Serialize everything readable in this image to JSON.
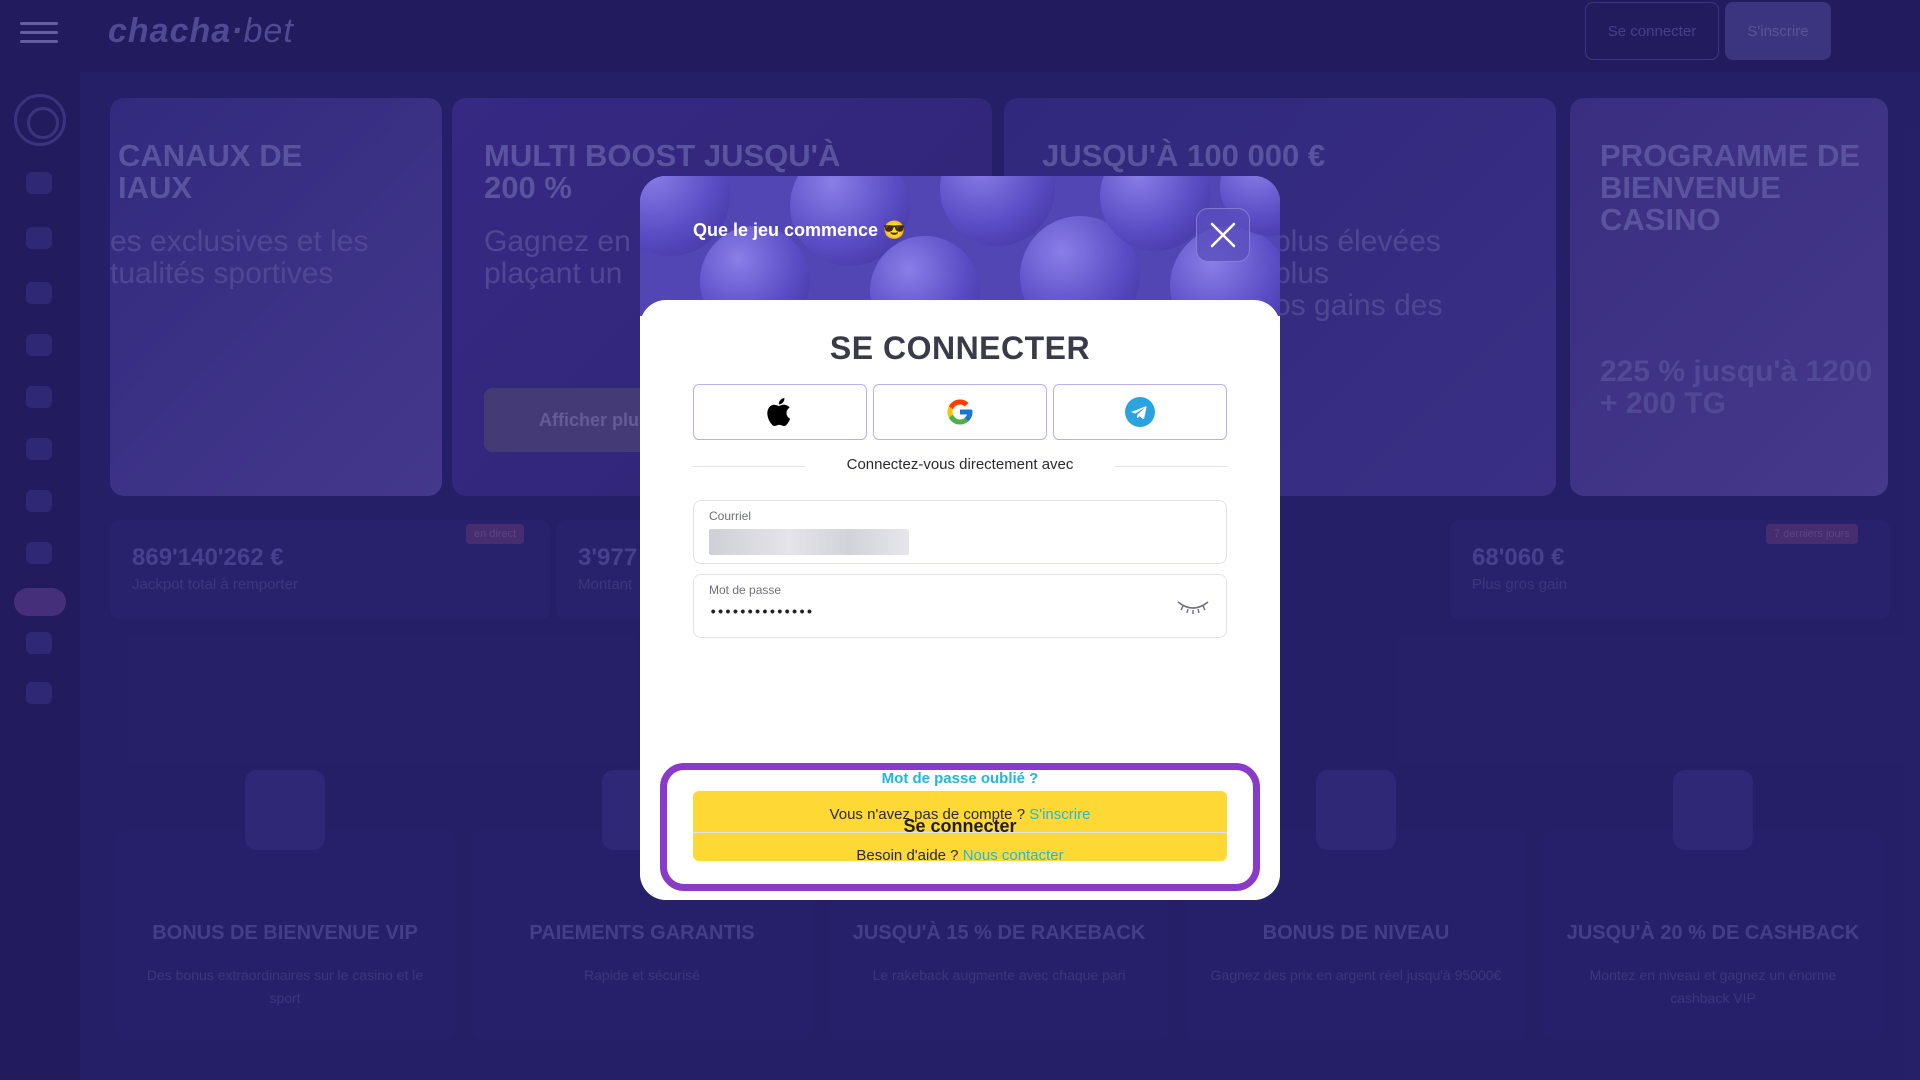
{
  "header": {
    "logo": "chacha",
    "logo_suffix": "bet",
    "login_label": "Se connecter",
    "signup_label": "S'inscrire"
  },
  "banners": [
    {
      "title": "CANAUX DE\nIAUX",
      "subtitle": "es exclusives et les\ntualités sportives"
    },
    {
      "title": "MULTI BOOST JUSQU'À\n200 %",
      "subtitle": "Gagnez en\nplaçant un",
      "button": "Afficher plus"
    },
    {
      "title": "JUSQU'À 100 000 €",
      "subtitle": "plus élevées\nplus\nos gains des"
    },
    {
      "title": "PROGRAMME DE\nBIENVENUE\n     CASINO",
      "promo": "225 % jusqu'à 1200\n+ 200 TG"
    }
  ],
  "stats": [
    {
      "value": "869'140'262 €",
      "label": "Jackpot total à remporter",
      "tag": "en direct"
    },
    {
      "value": "3'977",
      "label": "Montant"
    },
    {
      "value": "68'060 €",
      "label": "Plus gros gain",
      "tag": "7 derniers jours"
    }
  ],
  "features": [
    {
      "title": "BONUS DE BIENVENUE VIP",
      "desc": "Des bonus extraordinaires sur le casino et le sport"
    },
    {
      "title": "PAIEMENTS GARANTIS",
      "desc": "Rapide et sécurisé"
    },
    {
      "title": "JUSQU'À 15 % DE RAKEBACK",
      "desc": "Le rakeback augmente avec chaque pari"
    },
    {
      "title": "BONUS DE NIVEAU",
      "desc": "Gagnez des prix en argent réel jusqu'à 95000€"
    },
    {
      "title": "JUSQU'À 20 % DE CASHBACK",
      "desc": "Montez en niveau et gagnez un énorme cashback VIP"
    }
  ],
  "modal": {
    "title": "Que le jeu commence 😎",
    "heading": "SE CONNECTER",
    "social": [
      {
        "name": "apple-icon"
      },
      {
        "name": "google-icon"
      },
      {
        "name": "telegram-icon"
      }
    ],
    "direct_text": "Connectez-vous directement avec",
    "email": {
      "label": "Courriel"
    },
    "password": {
      "label": "Mot de passe",
      "value": "••••••••••••••"
    },
    "submit_label": "Se connecter",
    "forgot_label": "Mot de passe oublié ?",
    "no_account_text": "Vous n'avez pas de compte ?",
    "signup_link": "S'inscrire",
    "help_text": "Besoin d'aide ?",
    "contact_link": "Nous contacter",
    "colors": {
      "accent": "#fed935",
      "link": "#1fb8dc",
      "highlight": "#8a3ac8"
    }
  }
}
